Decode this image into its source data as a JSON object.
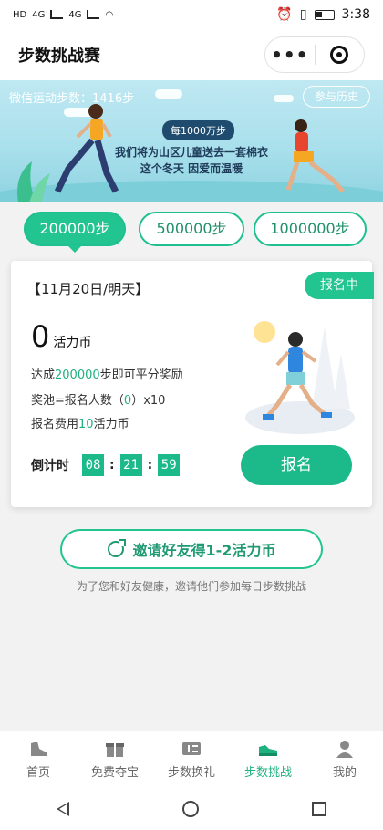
{
  "status_bar": {
    "left_badges": [
      "HD",
      "4G",
      "4G"
    ],
    "time": "3:38"
  },
  "header": {
    "title": "步数挑战赛",
    "more_icon": "more-dots-icon",
    "target_icon": "target-icon"
  },
  "banner": {
    "steps_label": "微信运动步数：1416步",
    "history_button": "参与历史",
    "pill": "每1000万步",
    "line1": "我们将为山区儿童送去一套棉衣",
    "line2": "这个冬天  因爱而温暖"
  },
  "tabs": [
    {
      "label": "200000步",
      "active": true
    },
    {
      "label": "500000步",
      "active": false
    },
    {
      "label": "1000000步",
      "active": false
    }
  ],
  "card": {
    "date": "【11月20日/明天】",
    "status_badge": "报名中",
    "coins": "0",
    "coins_unit": "活力币",
    "rule_prefix": "达成",
    "rule_steps": "200000",
    "rule_suffix": "步即可平分奖励",
    "pool_prefix": "奖池=报名人数（",
    "pool_count": "0",
    "pool_suffix": "）x10",
    "fee_prefix": "报名费用",
    "fee_amount": "10",
    "fee_suffix": "活力币",
    "countdown_label": "倒计时",
    "countdown": {
      "hh": "08",
      "mm": "21",
      "ss": "59"
    },
    "signup_button": "报名"
  },
  "invite": {
    "button": "邀请好友得1-2活力币",
    "subtitle": "为了您和好友健康，邀请他们参加每日步数挑战"
  },
  "bottom_nav": [
    {
      "label": "首页",
      "icon": "shoe-icon",
      "active": false
    },
    {
      "label": "免费夺宝",
      "icon": "gift-icon",
      "active": false
    },
    {
      "label": "步数换礼",
      "icon": "ticket-icon",
      "active": false
    },
    {
      "label": "步数挑战",
      "icon": "sneaker-icon",
      "active": true
    },
    {
      "label": "我的",
      "icon": "user-icon",
      "active": false
    }
  ],
  "colors": {
    "accent": "#22c48f",
    "accent_dark": "#1fb080",
    "banner_sky": "#bfe8f2"
  }
}
